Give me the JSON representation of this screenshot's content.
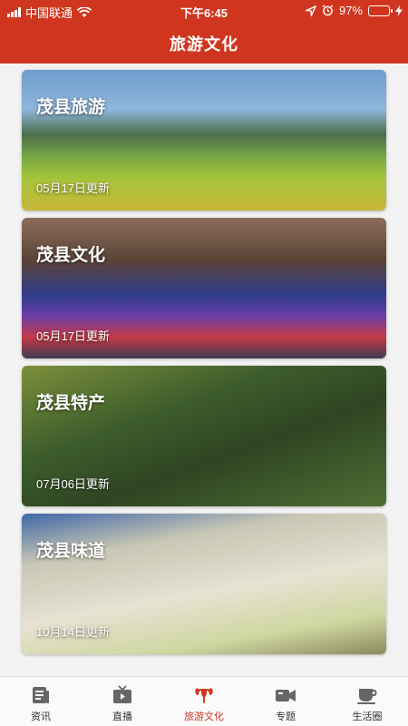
{
  "status_bar": {
    "carrier": "中国联通",
    "time": "下午6:45",
    "battery": "97%"
  },
  "header": {
    "title": "旅游文化"
  },
  "cards": [
    {
      "title": "茂县旅游",
      "date": "05月17日更新"
    },
    {
      "title": "茂县文化",
      "date": "05月17日更新"
    },
    {
      "title": "茂县特产",
      "date": "07月06日更新"
    },
    {
      "title": "茂县味道",
      "date": "10月14日更新"
    }
  ],
  "tabbar": {
    "items": [
      {
        "label": "资讯",
        "icon": "news-icon"
      },
      {
        "label": "直播",
        "icon": "tv-icon"
      },
      {
        "label": "旅游文化",
        "icon": "goat-icon"
      },
      {
        "label": "专题",
        "icon": "video-camera-icon"
      },
      {
        "label": "生活圈",
        "icon": "coffee-cup-icon"
      }
    ],
    "active_color": "#d0361f"
  },
  "colors": {
    "brand": "#d0361f",
    "battery": "#34d23b"
  }
}
